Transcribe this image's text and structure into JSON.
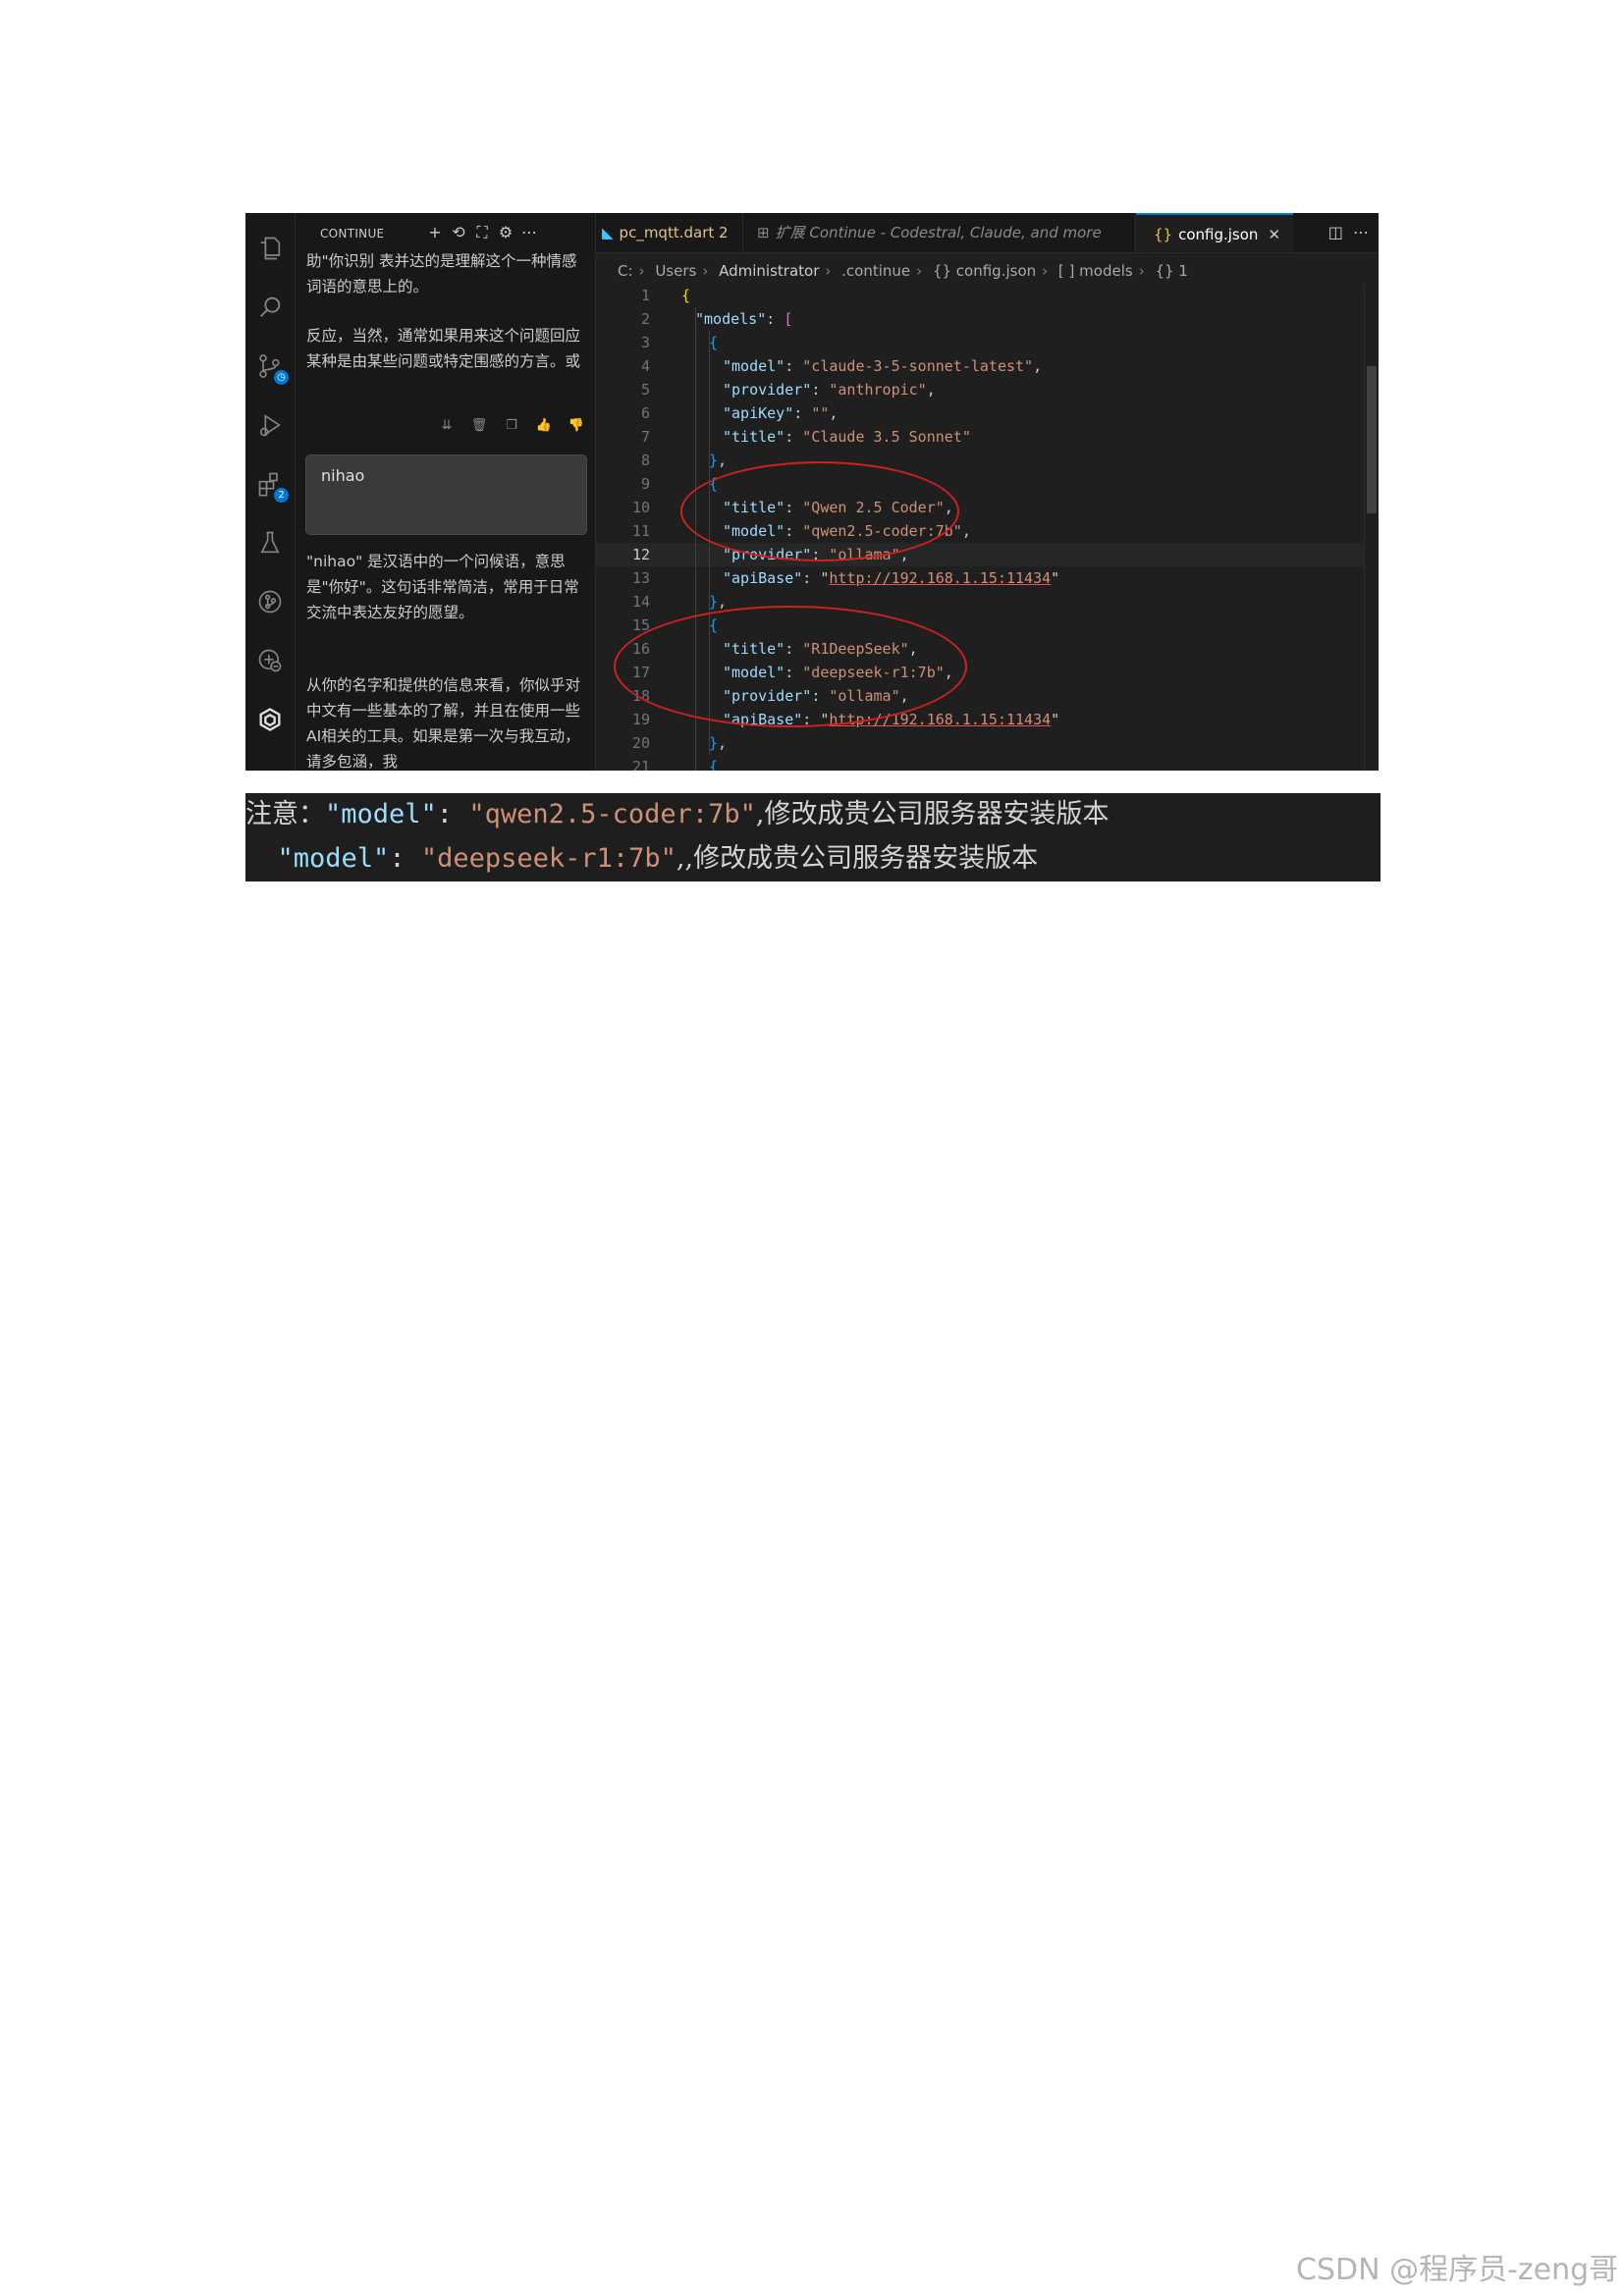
{
  "sidebar": {
    "title": "CONTINUE",
    "header_icons": [
      "plus-icon",
      "history-icon",
      "fullscreen-icon",
      "gear-icon",
      "more-icon"
    ],
    "chat": {
      "para1": "助\"你识别 表并达的是理解这个一种情感词语的意思上的。",
      "para2": "反应，当然，通常如果用来这个问题回应某种是由某些问题或特定围感的方言。或",
      "action_icons": [
        "insert-icon",
        "trash-icon",
        "copy-icon",
        "thumbs-up-icon",
        "thumbs-down-icon"
      ],
      "user_message": "nihao",
      "para3": "\"nihao\" 是汉语中的一个问候语，意思是\"你好\"。这句话非常简洁，常用于日常交流中表达友好的愿望。",
      "para4": "从你的名字和提供的信息来看，你似乎对中文有一些基本的了解，并且在使用一些AI相关的工具。如果是第一次与我互动，请多包涵，我"
    }
  },
  "activity_bar": {
    "icons": [
      "explorer-icon",
      "search-icon",
      "source-control-icon",
      "run-debug-icon",
      "extensions-icon",
      "testing-icon",
      "git-graph-icon",
      "remote-explorer-icon",
      "continue-icon"
    ],
    "extensions_badge": "2"
  },
  "tabs": [
    {
      "label": "pc_mqtt.dart 2",
      "icon": "dart-icon"
    },
    {
      "label": "扩展 Continue - Codestral, Claude, and more",
      "icon": "extension-icon"
    },
    {
      "label": "config.json",
      "icon": "json-icon",
      "active": true
    }
  ],
  "tab_actions": [
    "split-editor-icon",
    "more-icon"
  ],
  "breadcrumb": [
    "C:",
    "Users",
    "Administrator",
    ".continue",
    "{} config.json",
    "[ ] models",
    "{} 1"
  ],
  "editor": {
    "active_line": 12,
    "lines": [
      {
        "n": "1",
        "text": "{"
      },
      {
        "n": "2",
        "text": "\"models\": ["
      },
      {
        "n": "3",
        "text": "{"
      },
      {
        "n": "4",
        "text": "\"model\": \"claude-3-5-sonnet-latest\","
      },
      {
        "n": "5",
        "text": "\"provider\": \"anthropic\","
      },
      {
        "n": "6",
        "text": "\"apiKey\": \"\","
      },
      {
        "n": "7",
        "text": "\"title\": \"Claude 3.5 Sonnet\""
      },
      {
        "n": "8",
        "text": "},"
      },
      {
        "n": "9",
        "text": "{"
      },
      {
        "n": "10",
        "text": "\"title\": \"Qwen 2.5 Coder\","
      },
      {
        "n": "11",
        "text": "\"model\": \"qwen2.5-coder:7b\","
      },
      {
        "n": "12",
        "text": "\"provider\": \"ollama\","
      },
      {
        "n": "13",
        "text": "\"apiBase\": \"http://192.168.1.15:11434\""
      },
      {
        "n": "14",
        "text": "},"
      },
      {
        "n": "15",
        "text": "{"
      },
      {
        "n": "16",
        "text": "\"title\": \"R1DeepSeek\","
      },
      {
        "n": "17",
        "text": "\"model\": \"deepseek-r1:7b\","
      },
      {
        "n": "18",
        "text": "\"provider\": \"ollama\","
      },
      {
        "n": "19",
        "text": "\"apiBase\": \"http://192.168.1.15:11434\""
      },
      {
        "n": "20",
        "text": "},"
      },
      {
        "n": "21",
        "text": "{"
      }
    ]
  },
  "note": {
    "line1_prefix": "注意：",
    "line1_key": "\"model\"",
    "line1_colon": ": ",
    "line1_value": "\"qwen2.5-coder:7b\"",
    "line1_suffix": ",修改成贵公司服务器安装版本",
    "line2_indent": "  ",
    "line2_key": "\"model\"",
    "line2_colon": ": ",
    "line2_value": "\"deepseek-r1:7b\"",
    "line2_suffix": ",,修改成贵公司服务器安装版本"
  },
  "watermark": "CSDN @程序员-zeng哥",
  "colors": {
    "annotation": "#d02020",
    "active_tab_border": "#0078d4",
    "string": "#ce9178",
    "key": "#9cdcfe"
  }
}
